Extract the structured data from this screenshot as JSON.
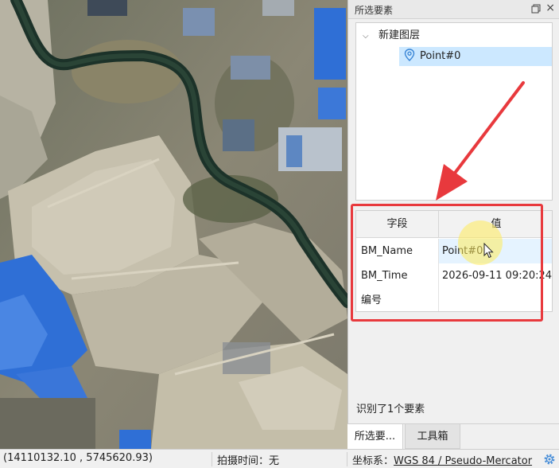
{
  "panel": {
    "title": "所选要素",
    "restore_icon": "restore-window-icon",
    "close_icon": "close-icon"
  },
  "tree": {
    "layer_label": "新建图层",
    "point_label": "Point#0",
    "point_icon": "map-pin-icon"
  },
  "attributes": {
    "header_field": "字段",
    "header_value": "值",
    "rows": [
      {
        "field": "BM_Name",
        "value": "Point#0"
      },
      {
        "field": "BM_Time",
        "value": "2026-09-11 09:20:24"
      },
      {
        "field": "编号",
        "value": ""
      }
    ]
  },
  "status": {
    "identified": "识别了1个要素"
  },
  "tabs": {
    "selected_features": "所选要...",
    "toolbox": "工具箱"
  },
  "statusbar": {
    "coordinates": "(14110132.10 , 5745620.93)",
    "capture_time": "拍摄时间：无",
    "crs_label": "坐标系：",
    "crs_value": "WGS 84 / Pseudo-Mercator",
    "settings_icon": "gear-icon"
  },
  "colors": {
    "highlight": "#e8393d",
    "selection": "#cce8ff",
    "roof_blue": "#2f6fd6"
  }
}
